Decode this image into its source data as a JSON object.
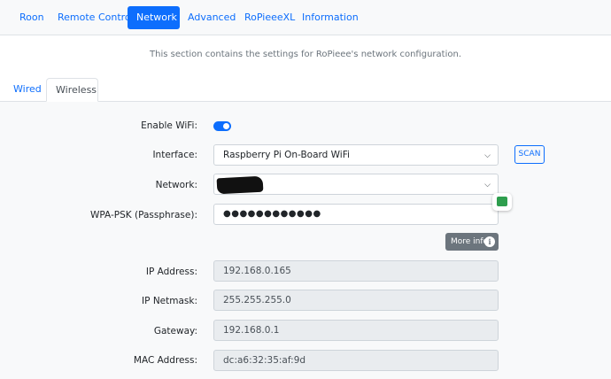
{
  "nav": {
    "tabs": [
      {
        "label": "Roon"
      },
      {
        "label": "Remote Control"
      },
      {
        "label": "Network",
        "active": true
      },
      {
        "label": "Advanced"
      },
      {
        "label": "RoPieeeXL"
      },
      {
        "label": "Information"
      }
    ]
  },
  "description": "This section contains the settings for RoPieee's network configuration.",
  "subtabs": [
    {
      "label": "Wired"
    },
    {
      "label": "Wireless",
      "active": true
    }
  ],
  "form": {
    "enable_wifi_label": "Enable WiFi:",
    "enable_wifi_on": true,
    "interface_label": "Interface:",
    "interface_value": "Raspberry Pi On-Board WiFi",
    "scan_label": "SCAN",
    "network_label": "Network:",
    "passphrase_label": "WPA-PSK (Passphrase):",
    "passphrase_value": "●●●●●●●●●●●●",
    "more_info_label": "More info",
    "ip_address_label": "IP Address:",
    "ip_address_value": "192.168.0.165",
    "ip_netmask_label": "IP Netmask:",
    "ip_netmask_value": "255.255.255.0",
    "gateway_label": "Gateway:",
    "gateway_value": "192.168.0.1",
    "mac_label": "MAC Address:",
    "mac_value": "dc:a6:32:35:af:9d"
  },
  "colors": {
    "accent": "#0d6efd",
    "secondary": "#6c757d",
    "extension_icon": "#2e9e4e"
  },
  "icons": {
    "select_chevron": "chevron-down-icon",
    "info": "info-icon",
    "extension": "password-manager-icon"
  }
}
